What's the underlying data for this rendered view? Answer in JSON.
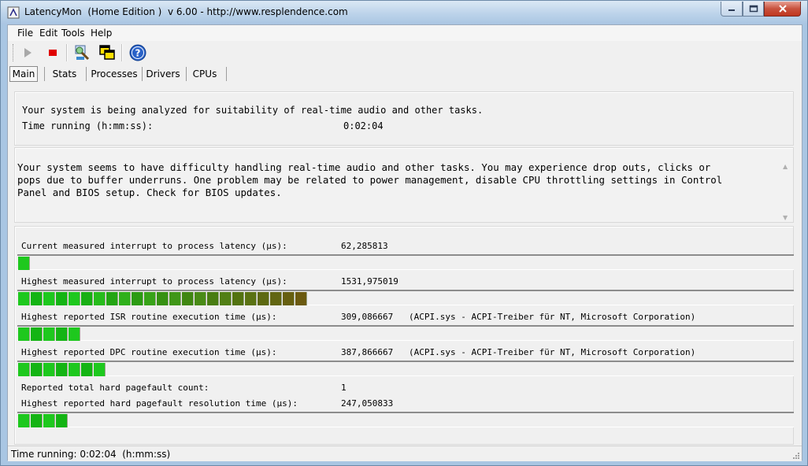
{
  "window": {
    "title": "LatencyMon  (Home Edition )  v 6.00 - http://www.resplendence.com"
  },
  "menu": [
    "File",
    "Edit",
    "Tools",
    "Help"
  ],
  "toolbar": {
    "icons": [
      "play-icon",
      "stop-icon",
      "search-tool-icon",
      "copy-windows-icon",
      "help-icon"
    ]
  },
  "tabs": [
    "Main",
    "Stats",
    "Processes",
    "Drivers",
    "CPUs"
  ],
  "active_tab": "Main",
  "status_panel": {
    "line1": "Your system is being analyzed for suitability of real-time audio and other tasks.",
    "time_label": "Time running (h:mm:ss):",
    "time_value": "0:02:04"
  },
  "conclusion": {
    "lines": [
      "Your system seems to have difficulty handling real-time audio and other tasks. You may experience drop outs, clicks or",
      "pops due to buffer underruns. One problem may be related to power management, disable CPU throttling settings in Control",
      "Panel and BIOS setup. Check for BIOS updates."
    ]
  },
  "metrics": [
    {
      "label": "Current measured interrupt to process latency (µs):",
      "value": "62,285813",
      "detail": "",
      "bar_segments": 1
    },
    {
      "label": "Highest measured interrupt to process latency (µs):",
      "value": "1531,975019",
      "detail": "",
      "bar_segments": 23
    },
    {
      "label": "Highest reported ISR routine execution time (µs):",
      "value": "309,086667",
      "detail": "(ACPI.sys - ACPI-Treiber für NT, Microsoft Corporation)",
      "bar_segments": 5
    },
    {
      "label": "Highest reported DPC routine execution time (µs):",
      "value": "387,866667",
      "detail": "(ACPI.sys - ACPI-Treiber für NT, Microsoft Corporation)",
      "bar_segments": 7
    },
    {
      "label": "Reported total hard pagefault count:",
      "value": "1",
      "detail": "",
      "bar_segments": null
    },
    {
      "label": "Highest reported hard pagefault resolution time (µs):",
      "value": "247,050833",
      "detail": "",
      "bar_segments": 4
    }
  ],
  "statusbar": {
    "text": "Time running: 0:02:04  (h:mm:ss)"
  },
  "colors": {
    "bar_green": "#1ec81e",
    "bar_olive": "#6b5a10"
  }
}
